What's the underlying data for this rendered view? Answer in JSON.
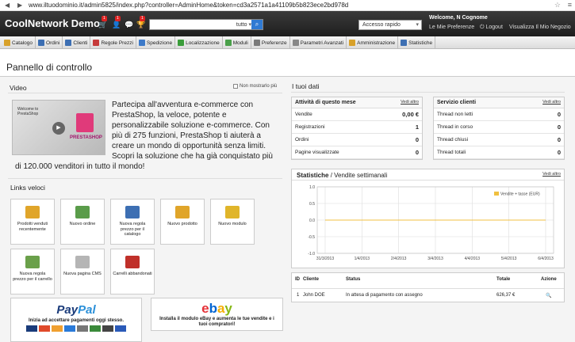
{
  "browser": {
    "url": "www.iltuodominio.it/admin5825/index.php?controller=AdminHome&token=cd3a2571a1a41109b5b823ece2bd978d"
  },
  "header": {
    "brand": "CoolNetwork Demo",
    "badges": [
      "1",
      "1",
      "1"
    ],
    "search_value": "tutto",
    "quick_access": "Accesso rapido",
    "welcome": "Welcome, N Cognome",
    "links": {
      "preferences": "Le Mie Preferenze",
      "logout": "Logout",
      "view_store": "Visualizza Il Mio Negozio"
    }
  },
  "tabs": [
    {
      "label": "Catalogo",
      "color": "#d8a12a"
    },
    {
      "label": "Ordini",
      "color": "#3d6fb3"
    },
    {
      "label": "Clienti",
      "color": "#3d6fb3"
    },
    {
      "label": "Regole Prezzi",
      "color": "#c63b3b"
    },
    {
      "label": "Spedizione",
      "color": "#3d7ac9"
    },
    {
      "label": "Localizzazione",
      "color": "#3a9d3a"
    },
    {
      "label": "Moduli",
      "color": "#4aa04a"
    },
    {
      "label": "Preferenze",
      "color": "#7a7a7a"
    },
    {
      "label": "Parametri Avanzati",
      "color": "#888888"
    },
    {
      "label": "Amministrazione",
      "color": "#d8a12a"
    },
    {
      "label": "Statistiche",
      "color": "#3d6fb3"
    }
  ],
  "page": {
    "title": "Pannello di controllo"
  },
  "video": {
    "heading": "Video",
    "checkbox": "Non mostrarlo più",
    "thumb_text": "Welcome to PrestaShop",
    "thumb_brand": "PRESTASHOP",
    "text": "Partecipa all'avventura e-commerce con PrestaShop, la veloce, potente e personalizzabile soluzione e-commerce. Con più di 275 funzioni, PrestaShop ti aiuterà a creare un mondo di opportunità senza limiti. Scopri la soluzione che ha già conquistato più",
    "text2": "di 120.000 venditori in tutto il mondo!"
  },
  "quicklinks": {
    "heading": "Links veloci",
    "items": [
      {
        "label": "Prodotti venduti recentemente",
        "color": "#e0a52a"
      },
      {
        "label": "Nuovo ordine",
        "color": "#5a9c4a"
      },
      {
        "label": "Nuova regola prezzo per il catalogo",
        "color": "#3d6fb3"
      },
      {
        "label": "Nuovo prodotto",
        "color": "#e0a52a"
      },
      {
        "label": "Nuovo modulo",
        "color": "#e0b52a"
      },
      {
        "label": "Nuova regola prezzo per il carrello",
        "color": "#6aa04a"
      },
      {
        "label": "Nuova pagina CMS",
        "color": "#b5b5b5"
      },
      {
        "label": "Carrelli abbandonati",
        "color": "#c0302a"
      }
    ]
  },
  "banners": {
    "paypal": {
      "logo_a": "Pay",
      "logo_b": "Pal",
      "text": "Inizia ad accettare pagamenti oggi stesso."
    },
    "ebay": {
      "logo": [
        "e",
        "b",
        "a",
        "y"
      ],
      "text": "Installa il modulo eBay e aumenta le tue vendite e i tuoi compratori!"
    }
  },
  "data": {
    "heading": "I tuoi dati",
    "activity": {
      "title": "Attività di questo mese",
      "more": "Vedi altro",
      "rows": [
        {
          "label": "Vendite",
          "value": "0,00 €"
        },
        {
          "label": "Registrazioni",
          "value": "1"
        },
        {
          "label": "Ordini",
          "value": "0"
        },
        {
          "label": "Pagine visualizzate",
          "value": "0"
        }
      ]
    },
    "service": {
      "title": "Servizio clienti",
      "more": "Vedi altro",
      "rows": [
        {
          "label": "Thread non letti",
          "value": "0"
        },
        {
          "label": "Thread in corso",
          "value": "0"
        },
        {
          "label": "Thread chiusi",
          "value": "0"
        },
        {
          "label": "Thread totali",
          "value": "0"
        }
      ]
    }
  },
  "stats": {
    "title_a": "Statistiche",
    "title_b": " / Vendite settimanali",
    "more": "Vedi altro"
  },
  "chart_data": {
    "type": "line",
    "x": [
      "31/3/2013",
      "1/4/2013",
      "2/4/2013",
      "3/4/2013",
      "4/4/2013",
      "5/4/2013",
      "6/4/2013"
    ],
    "series": [
      {
        "name": "Vendite + tasse (EUR)",
        "values": [
          0,
          0,
          0,
          0,
          0,
          0,
          0
        ],
        "color": "#f0c040"
      }
    ],
    "yticks": [
      "1.0",
      "0.5",
      "0.0",
      "-0.5",
      "-1.0"
    ],
    "ylim": [
      -1,
      1
    ],
    "legend": "top-right"
  },
  "orders": {
    "headers": {
      "id": "ID",
      "client": "Cliente",
      "status": "Status",
      "total": "Totale",
      "action": "Azione"
    },
    "rows": [
      {
        "id": "1",
        "client": "John DOE",
        "status": "In attesa di pagamento con assegno",
        "total": "626,37 €"
      }
    ]
  }
}
